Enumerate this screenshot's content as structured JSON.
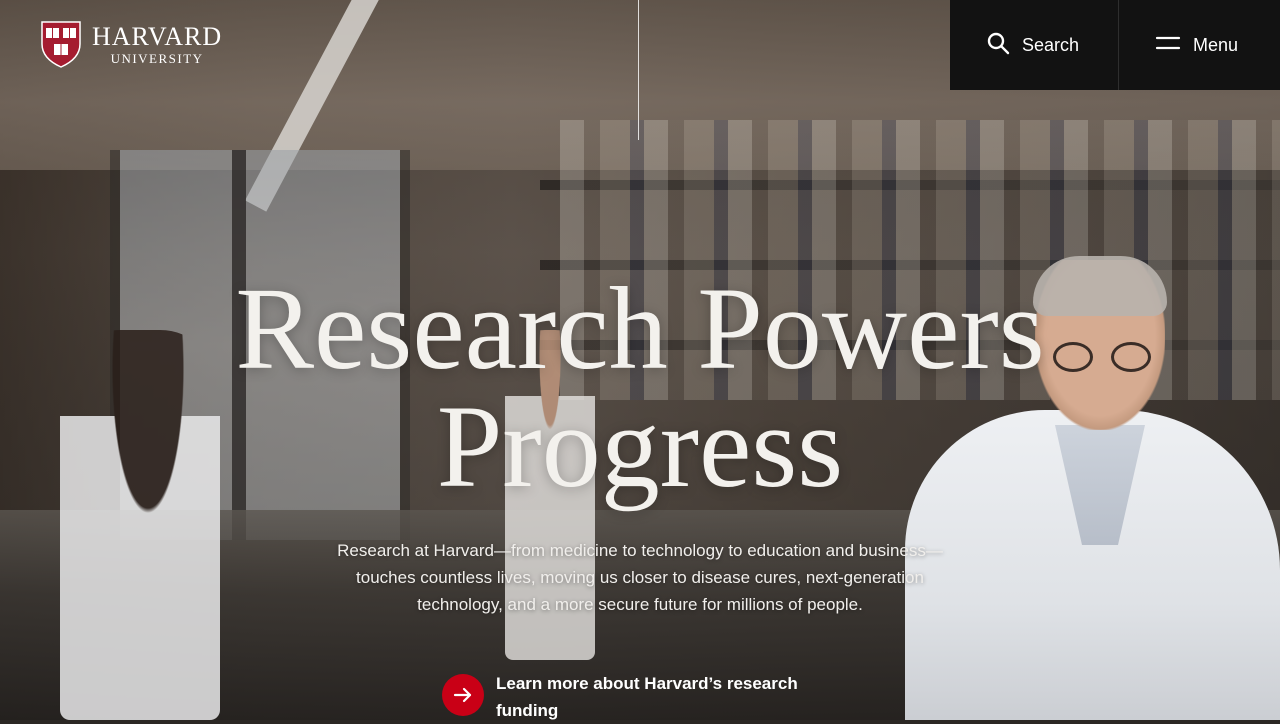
{
  "brand": {
    "name": "HARVARD",
    "sub": "UNIVERSITY",
    "shield_text_top": "VE RI TAS",
    "crimson": "#c90016"
  },
  "topbar": {
    "search_label": "Search",
    "menu_label": "Menu",
    "search_icon": "search-icon",
    "menu_icon": "hamburger-icon"
  },
  "hero": {
    "headline_line1": "Research Powers",
    "headline_line2": "Progress",
    "description": "Research at Harvard—from medicine to technology to education and business—touches countless lives, moving us closer to disease cures, next-generation technology, and a more secure future for millions of people.",
    "cta_label": "Learn more about Harvard’s research funding",
    "cta_icon": "arrow-right-icon"
  }
}
